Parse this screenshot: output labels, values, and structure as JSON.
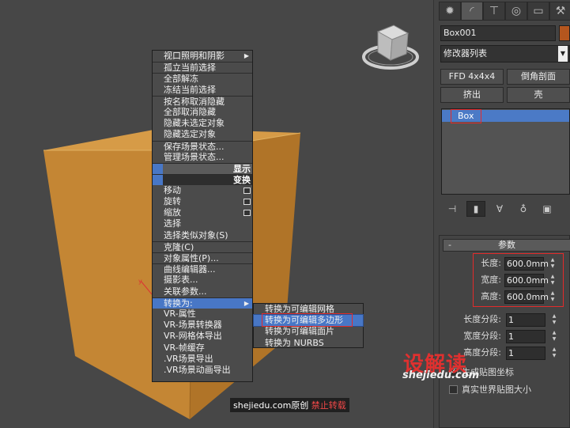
{
  "quad_menu": {
    "items_top": [
      {
        "label": "视口照明和阴影",
        "submenu": true
      },
      {
        "label": "孤立当前选择"
      },
      {
        "label": "全部解冻"
      },
      {
        "label": "冻结当前选择"
      },
      {
        "label": "按名称取消隐藏"
      },
      {
        "label": "全部取消隐藏"
      },
      {
        "label": "隐藏未选定对象"
      },
      {
        "label": "隐藏选定对象"
      },
      {
        "label": "保存场景状态..."
      },
      {
        "label": "管理场景状态..."
      }
    ],
    "header_display": "显示",
    "header_transform": "变换",
    "items_bottom": [
      {
        "label": "移动"
      },
      {
        "label": "旋转"
      },
      {
        "label": "缩放"
      },
      {
        "label": "选择"
      },
      {
        "label": "选择类似对象(S)"
      },
      {
        "label": "克隆(C)"
      },
      {
        "label": "对象属性(P)..."
      },
      {
        "label": "曲线编辑器..."
      },
      {
        "label": "摄影表..."
      },
      {
        "label": "关联参数..."
      },
      {
        "label": "转换为:"
      },
      {
        "label": "VR-属性"
      },
      {
        "label": "VR-场景转换器"
      },
      {
        "label": "VR-网格体导出"
      },
      {
        "label": "VR-帧缓存"
      },
      {
        "label": ".VR场景导出"
      },
      {
        "label": ".VR场景动画导出"
      }
    ]
  },
  "submenu": {
    "items": [
      {
        "label": "转换为可编辑网格"
      },
      {
        "label": "转换为可编辑多边形"
      },
      {
        "label": "转换为可编辑面片"
      },
      {
        "label": "转换为 NURBS"
      }
    ]
  },
  "panel": {
    "object_name": "Box001",
    "object_color": "#b5561e",
    "modifier_list": "修改器列表",
    "buttons": [
      "FFD 4x4x4",
      "倒角剖面",
      "挤出",
      "壳"
    ],
    "stack_item": "Box",
    "rollout_title": "参数",
    "params": [
      {
        "label": "长度:",
        "value": "600.0mm"
      },
      {
        "label": "宽度:",
        "value": "600.0mm"
      },
      {
        "label": "高度:",
        "value": "600.0mm"
      }
    ],
    "segments": [
      {
        "label": "长度分段:",
        "value": "1"
      },
      {
        "label": "宽度分段:",
        "value": "1"
      },
      {
        "label": "高度分段:",
        "value": "1"
      }
    ],
    "checkboxes": [
      {
        "label": "生成贴图坐标",
        "checked": true
      },
      {
        "label": "真实世界贴图大小",
        "checked": false
      }
    ]
  },
  "watermark": {
    "logo": "设解读",
    "site": "shejiedu.com",
    "credit_site": "shejiedu.com原创",
    "credit_warn": "禁止转载"
  },
  "colors": {
    "box_front": "#c98a3a",
    "box_top": "#d9a24c",
    "box_side": "#a36a28",
    "highlight": "#4877c6",
    "red_outline": "#e32b2b"
  }
}
